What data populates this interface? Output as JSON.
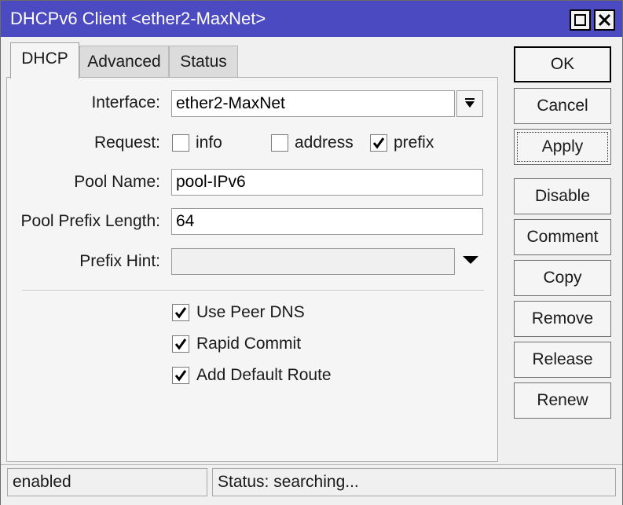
{
  "window": {
    "title": "DHCPv6 Client <ether2-MaxNet>",
    "titlebar_color": "#4c4ac1",
    "controls": [
      "maximize-icon",
      "close-icon"
    ]
  },
  "tabs": [
    {
      "label": "DHCP",
      "active": true
    },
    {
      "label": "Advanced",
      "active": false
    },
    {
      "label": "Status",
      "active": false
    }
  ],
  "form": {
    "interface_label": "Interface:",
    "interface_value": "ether2-MaxNet",
    "request_label": "Request:",
    "request_options": [
      {
        "label": "info",
        "checked": false
      },
      {
        "label": "address",
        "checked": false
      },
      {
        "label": "prefix",
        "checked": true
      }
    ],
    "pool_name_label": "Pool Name:",
    "pool_name_value": "pool-IPv6",
    "pool_prefix_length_label": "Pool Prefix Length:",
    "pool_prefix_length_value": "64",
    "prefix_hint_label": "Prefix Hint:",
    "prefix_hint_value": "",
    "use_peer_dns": {
      "label": "Use Peer DNS",
      "checked": true
    },
    "rapid_commit": {
      "label": "Rapid Commit",
      "checked": true
    },
    "add_default_route": {
      "label": "Add Default Route",
      "checked": true
    }
  },
  "buttons": {
    "ok": "OK",
    "cancel": "Cancel",
    "apply": "Apply",
    "disable": "Disable",
    "comment": "Comment",
    "copy": "Copy",
    "remove": "Remove",
    "release": "Release",
    "renew": "Renew"
  },
  "statusbar": {
    "left": "enabled",
    "right": "Status: searching..."
  }
}
